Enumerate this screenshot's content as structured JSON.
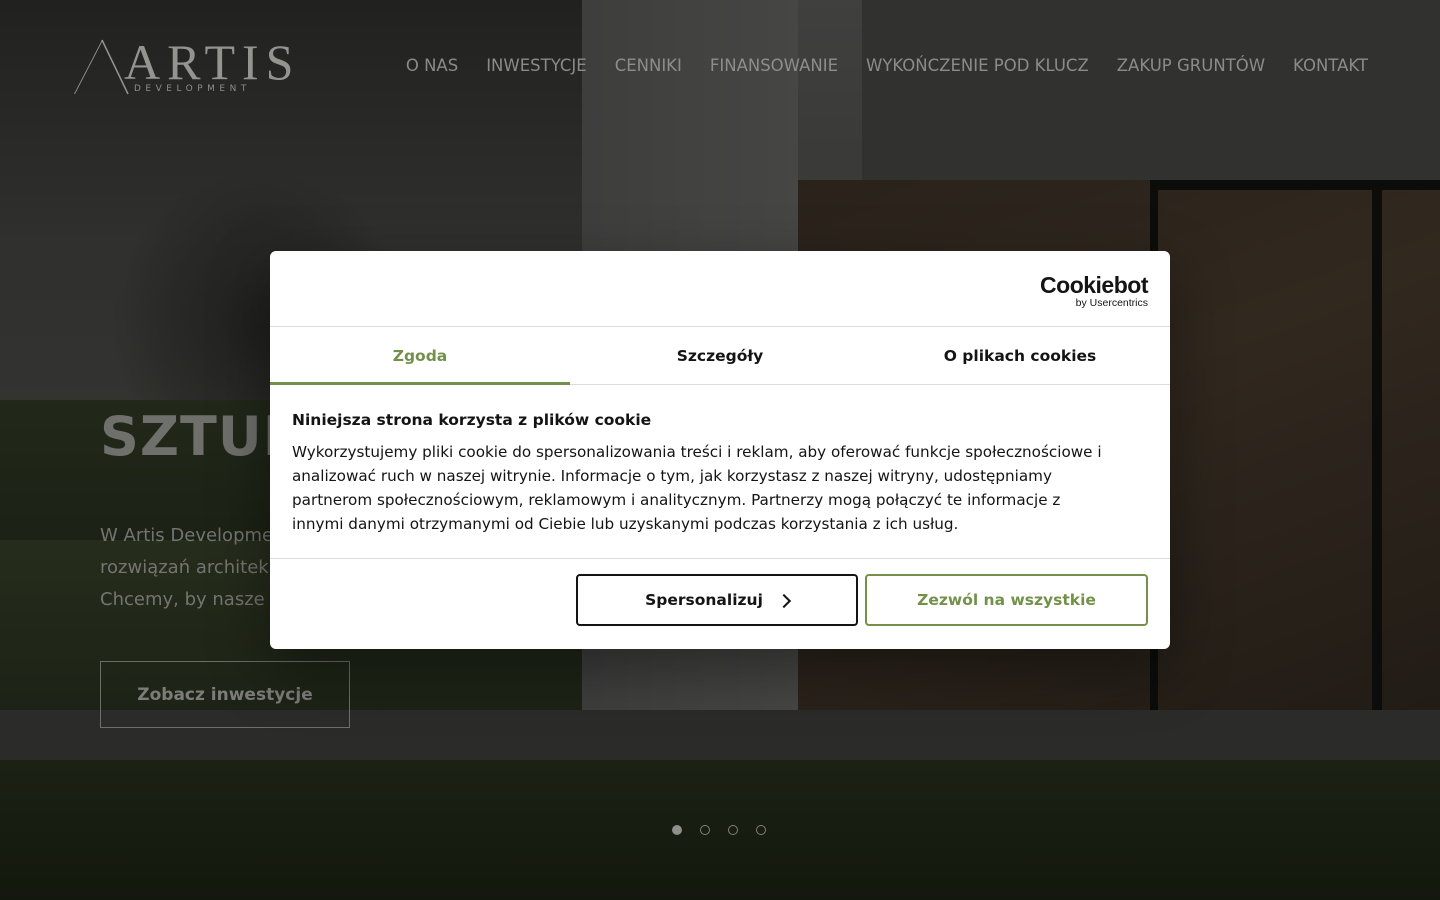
{
  "header": {
    "logo_word": "ARTIS",
    "logo_sub": "DEVELOPMENT",
    "nav": [
      {
        "label": "O NAS"
      },
      {
        "label": "INWESTYCJE"
      },
      {
        "label": "CENNIKI"
      },
      {
        "label": "FINANSOWANIE"
      },
      {
        "label": "WYKOŃCZENIE POD KLUCZ"
      },
      {
        "label": "ZAKUP GRUNTÓW"
      },
      {
        "label": "KONTAKT"
      }
    ]
  },
  "hero": {
    "title": "SZTUK",
    "text_lines": [
      "W Artis Developme",
      "rozwiązań architek",
      "Chcemy, by nasze"
    ],
    "cta_label": "Zobacz inwestycje",
    "slides": {
      "count": 4,
      "active_index": 0
    }
  },
  "cookie_dialog": {
    "brand": "Cookiebot",
    "brand_sub": "by Usercentrics",
    "tabs": [
      {
        "label": "Zgoda",
        "active": true
      },
      {
        "label": "Szczegóły",
        "active": false
      },
      {
        "label": "O plikach cookies",
        "active": false
      }
    ],
    "title": "Niniejsza strona korzysta z plików cookie",
    "text_lines": [
      "Wykorzystujemy pliki cookie do spersonalizowania treści i reklam, aby oferować funkcje społecznościowe i",
      "analizować ruch w naszej witrynie. Informacje o tym, jak korzystasz z naszej witryny, udostępniamy",
      "partnerom społecznościowym, reklamowym i analitycznym. Partnerzy mogą połączyć te informacje z",
      "innymi danymi otrzymanymi od Ciebie lub uzyskanymi podczas korzystania z ich usług."
    ],
    "customize_label": "Spersonalizuj",
    "allow_all_label": "Zezwól na wszystkie",
    "accent_color": "#74914b"
  }
}
